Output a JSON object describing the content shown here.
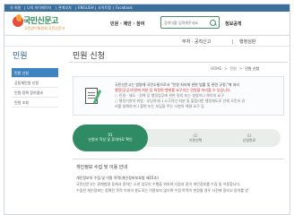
{
  "utility": {
    "items": [
      "유 회원",
      "나의 마이페이지",
      "관계부처",
      "ENGLISH",
      "사이트맵",
      "Facebook"
    ]
  },
  "header": {
    "logo_text": "국민신문고",
    "logo_sub": "국민권익위원회 국민신문고",
    "menu_label": "민원 · 제안 · 참여",
    "search_placeholder": "검색어를 입력해주세요",
    "info_label": "정보공개"
  },
  "nav": {
    "gov_label": "부처 · 공직신고",
    "admin_label": "행정심판"
  },
  "sidebar": {
    "title": "민원",
    "items": [
      {
        "label": "민원 신청",
        "active": true
      },
      {
        "label": "공동체민원 신청",
        "active": false
      },
      {
        "label": "민원·정책 참여결과",
        "active": false
      },
      {
        "label": "민원 조회",
        "active": false
      }
    ]
  },
  "content": {
    "title": "민원 신청",
    "breadcrumb": {
      "home": "HOME",
      "sep1": ">",
      "level1": "민원",
      "sep2": ">",
      "current": "민원 신청"
    },
    "notice": {
      "line1": "국민신문고는 법령에 국민소통으로서 \"민원 처리에 관한 법률 및 관련 규정,\"에 처리",
      "line2": "행정(공공)기관에 처분 등 특정한 행위를 요구하는 민원을 처리할 수 있습니다.",
      "line3": "○ 민원 · 제도 · 정책 등 행정업무에 관한 질의 또는 설명이나 해석의 요구",
      "line4": "○ 행정기관의 위법 · 부당하거나 소극적인 처분 및 불합리한 행정제도로 인해 국민의 권",
      "line5": "리를 침해하거나 불편 또는 부담을 주는 사항의 해결 요구 등"
    },
    "steps": [
      {
        "num": "01",
        "label": "신청서 작성 및 휴대자료 확인"
      },
      {
        "num": "02",
        "label": "기관선택"
      },
      {
        "num": "03",
        "label": "신청완료"
      }
    ],
    "section_title": "개인정보 수집 및 이용 안내",
    "section_lines": [
      "개인정보의 수집 및 이용 목적(개인정보보호법 제15조)",
      "국민신문고는 관계법령 등에서 정하는 소관 업무의 수행을 위하여 다음과 같이 개인정보를 수집 및 이용합니다.",
      "수집된 개인정보는 정해진 목적 이외의 용도로는 이용되지 않으며 수집 목적이 변경될 경우 사전에 알리고 동의를 받"
    ]
  }
}
